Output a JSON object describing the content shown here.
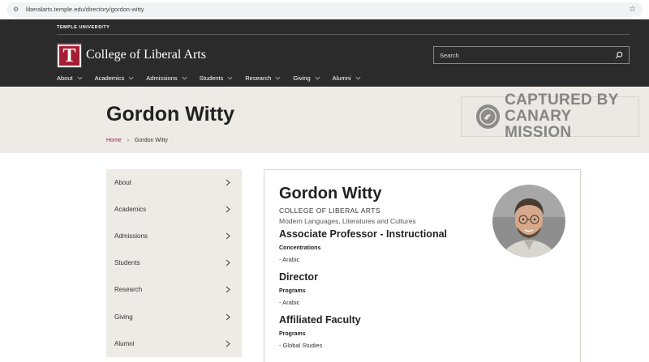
{
  "browser": {
    "url": "liberalarts.temple.edu/directory/gordon-witty"
  },
  "header": {
    "university": "TEMPLE UNIVERSITY",
    "college": "College of Liberal Arts",
    "logo_letter": "T",
    "search_placeholder": "Search",
    "nav": [
      {
        "label": "About"
      },
      {
        "label": "Academics"
      },
      {
        "label": "Admissions"
      },
      {
        "label": "Students"
      },
      {
        "label": "Research"
      },
      {
        "label": "Giving"
      },
      {
        "label": "Alumni"
      }
    ]
  },
  "hero": {
    "title": "Gordon Witty",
    "breadcrumb": {
      "home": "Home",
      "sep": "›",
      "current": "Gordon Witty"
    },
    "watermark": {
      "line1": "CAPTURED BY",
      "line2": "CANARY MISSION"
    }
  },
  "side_menu": [
    {
      "label": "About"
    },
    {
      "label": "Academics"
    },
    {
      "label": "Admissions"
    },
    {
      "label": "Students"
    },
    {
      "label": "Research"
    },
    {
      "label": "Giving"
    },
    {
      "label": "Alumni"
    }
  ],
  "profile": {
    "name": "Gordon Witty",
    "college": "COLLEGE OF LIBERAL ARTS",
    "department": "Modern Languages, Literatures and Cultures",
    "sections": [
      {
        "role": "Associate Professor - Instructional",
        "label": "Concentrations",
        "value": "- Arabic"
      },
      {
        "role": "Director",
        "label": "Programs",
        "value": "- Arabic"
      },
      {
        "role": "Affiliated Faculty",
        "label": "Programs",
        "value": "- Global Studies"
      }
    ]
  },
  "colors": {
    "brand": "#a41e35",
    "header_bg": "#2b2b2b",
    "hero_bg": "#eeebe6"
  }
}
